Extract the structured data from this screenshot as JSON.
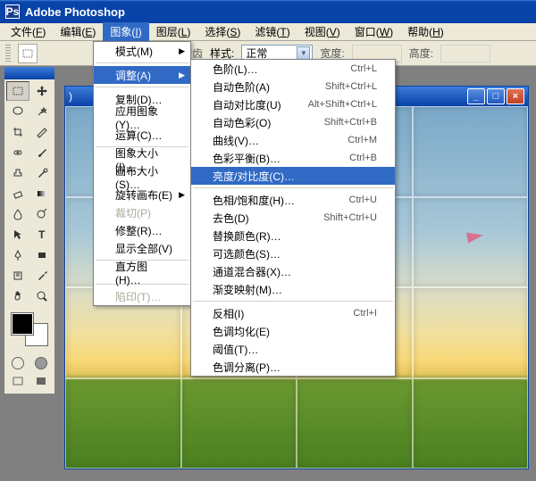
{
  "app": {
    "title": "Adobe Photoshop",
    "ps_icon_text": "Ps"
  },
  "menubar": [
    {
      "label": "文件",
      "key": "F"
    },
    {
      "label": "编辑",
      "key": "E"
    },
    {
      "label": "图象",
      "key": "I",
      "active": true
    },
    {
      "label": "图层",
      "key": "L"
    },
    {
      "label": "选择",
      "key": "S"
    },
    {
      "label": "滤镜",
      "key": "T"
    },
    {
      "label": "视图",
      "key": "V"
    },
    {
      "label": "窗口",
      "key": "W"
    },
    {
      "label": "帮助",
      "key": "H"
    }
  ],
  "optbar": {
    "antialias_label": "消除锯齿",
    "style_label": "样式:",
    "style_value": "正常",
    "width_label": "宽度:",
    "height_label": "高度:"
  },
  "dropdown1": [
    {
      "label": "模式(M)",
      "submenu": true
    },
    {
      "sep": true
    },
    {
      "label": "调整(A)",
      "submenu": true,
      "hl": true
    },
    {
      "sep": true
    },
    {
      "label": "复制(D)…"
    },
    {
      "label": "应用图象(Y)…"
    },
    {
      "label": "运算(C)…"
    },
    {
      "sep": true
    },
    {
      "label": "图象大小(I)…"
    },
    {
      "label": "画布大小(S)…"
    },
    {
      "label": "旋转画布(E)",
      "submenu": true
    },
    {
      "label": "裁切(P)",
      "disabled": true
    },
    {
      "label": "修整(R)…"
    },
    {
      "label": "显示全部(V)"
    },
    {
      "sep": true
    },
    {
      "label": "直方图(H)…"
    },
    {
      "sep": true
    },
    {
      "label": "陷印(T)…",
      "disabled": true
    }
  ],
  "dropdown2": [
    {
      "label": "色阶(L)…",
      "shortcut": "Ctrl+L"
    },
    {
      "label": "自动色阶(A)",
      "shortcut": "Shift+Ctrl+L"
    },
    {
      "label": "自动对比度(U)",
      "shortcut": "Alt+Shift+Ctrl+L"
    },
    {
      "label": "自动色彩(O)",
      "shortcut": "Shift+Ctrl+B"
    },
    {
      "label": "曲线(V)…",
      "shortcut": "Ctrl+M"
    },
    {
      "label": "色彩平衡(B)…",
      "shortcut": "Ctrl+B"
    },
    {
      "label": "亮度/对比度(C)…",
      "hl": true
    },
    {
      "sep": true
    },
    {
      "label": "色相/饱和度(H)…",
      "shortcut": "Ctrl+U"
    },
    {
      "label": "去色(D)",
      "shortcut": "Shift+Ctrl+U"
    },
    {
      "label": "替换颜色(R)…"
    },
    {
      "label": "可选颜色(S)…"
    },
    {
      "label": "通道混合器(X)…"
    },
    {
      "label": "渐变映射(M)…"
    },
    {
      "sep": true
    },
    {
      "label": "反相(I)",
      "shortcut": "Ctrl+I"
    },
    {
      "label": "色调均化(E)"
    },
    {
      "label": "阈值(T)…"
    },
    {
      "label": "色调分离(P)…"
    }
  ],
  "docwin": {
    "title_suffix": ")",
    "min": "_",
    "max": "□",
    "close": "×"
  }
}
